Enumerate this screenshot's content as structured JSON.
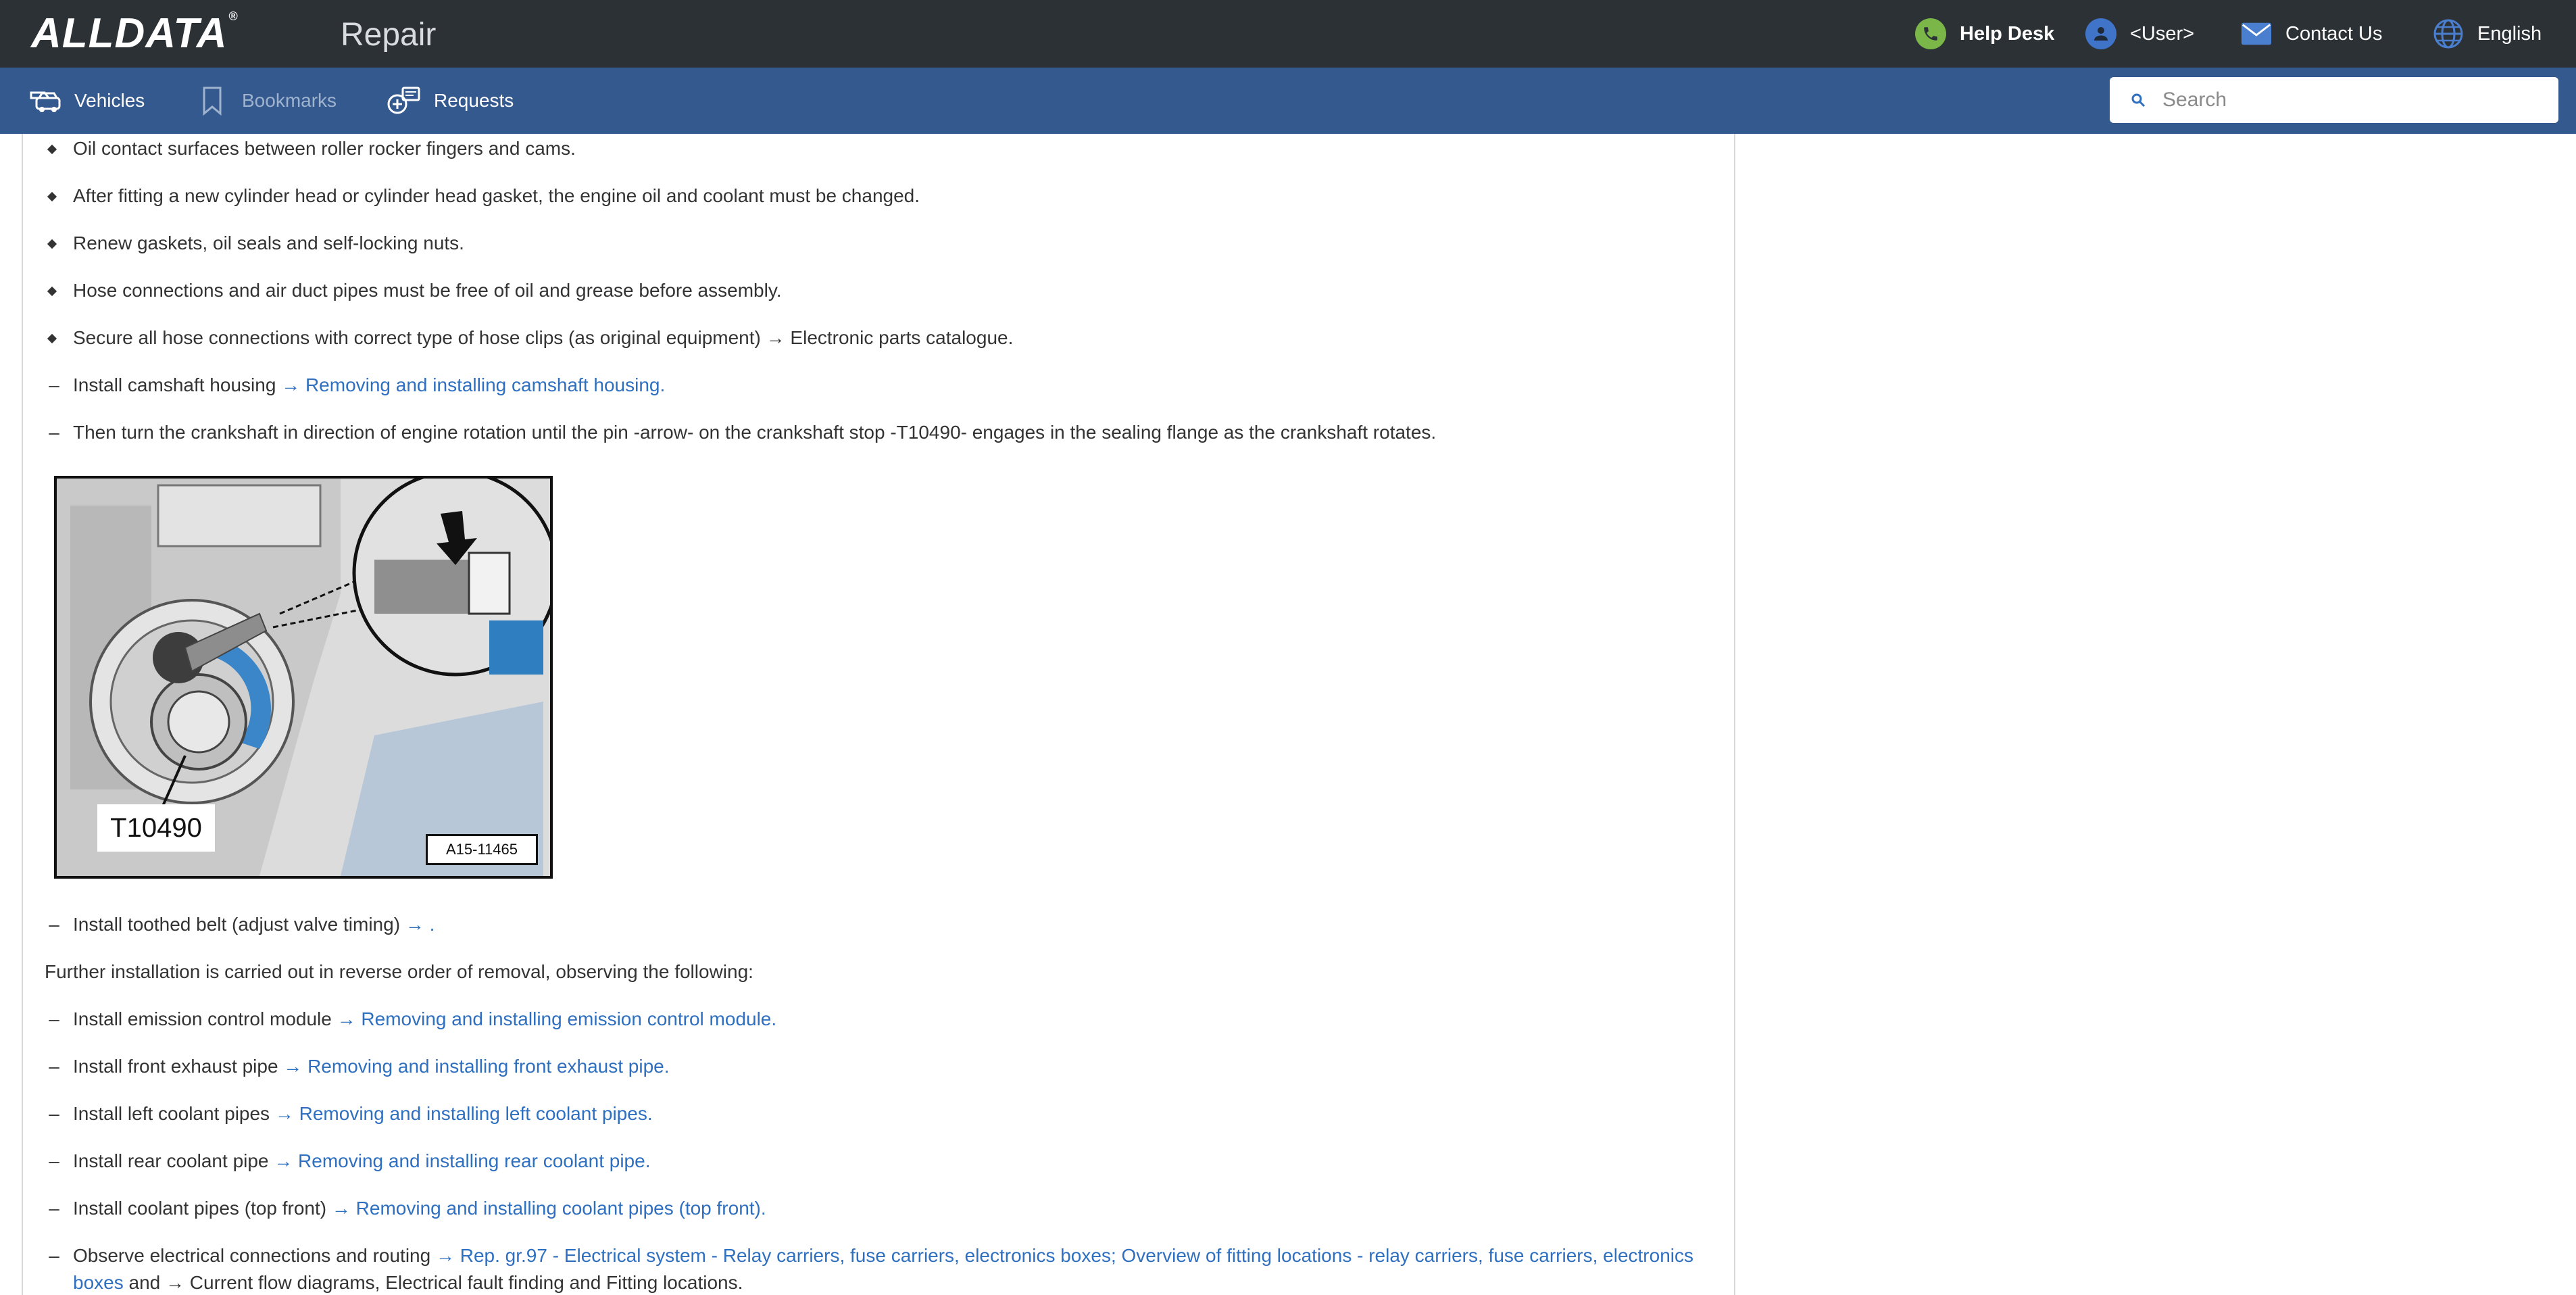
{
  "header": {
    "logo_text": "ALLDATA",
    "app_title": "Repair",
    "help_desk": "Help Desk",
    "user": "<User>",
    "contact": "Contact Us",
    "language": "English"
  },
  "nav": {
    "vehicles": "Vehicles",
    "bookmarks": "Bookmarks",
    "requests": "Requests",
    "search_placeholder": "Search"
  },
  "content": {
    "bullets": [
      "Oil contact surfaces between roller rocker fingers and cams.",
      "After fitting a new cylinder head or cylinder head gasket, the engine oil and coolant must be changed.",
      "Renew gaskets, oil seals and self-locking nuts.",
      "Hose connections and air duct pipes must be free of oil and grease before assembly.",
      "Secure all hose connections with correct type of hose clips (as original equipment) → Electronic parts catalogue."
    ],
    "step_camshaft": {
      "text": "Install camshaft housing ",
      "link": "→ Removing and installing camshaft housing."
    },
    "step_crank": "Then turn the crankshaft in direction of engine rotation until the pin -arrow- on the crankshaft stop -T10490- engages in the sealing flange as the crankshaft rotates.",
    "figure": {
      "label": "T10490",
      "code": "A15-11465"
    },
    "step_belt": {
      "text": "Install toothed belt (adjust valve timing) ",
      "link": "→ ."
    },
    "further": "Further installation is carried out in reverse order of removal, observing the following:",
    "steps": [
      {
        "text": "Install emission control module ",
        "link": "→ Removing and installing emission control module."
      },
      {
        "text": "Install front exhaust pipe ",
        "link": "→ Removing and installing front exhaust pipe."
      },
      {
        "text": "Install left coolant pipes ",
        "link": "→ Removing and installing left coolant pipes."
      },
      {
        "text": "Install rear coolant pipe ",
        "link": "→ Removing and installing rear coolant pipe."
      },
      {
        "text": "Install coolant pipes (top front) ",
        "link": "→ Removing and installing coolant pipes (top front)."
      }
    ],
    "step_electrical": {
      "text": "Observe electrical connections and routing ",
      "link1": "→ Rep. gr.97 - Electrical system - Relay carriers, fuse carriers, electronics boxes; Overview of fitting locations - relay carriers, fuse carriers, electronics",
      "link2": "boxes",
      "tail": " and → Current flow diagrams, Electrical fault finding and Fitting locations."
    }
  },
  "colors": {
    "topbar": "#2c3136",
    "navbar": "#34598f",
    "link": "#2f6fc0",
    "help_icon": "#7ab648",
    "user_icon": "#3f74c8"
  }
}
